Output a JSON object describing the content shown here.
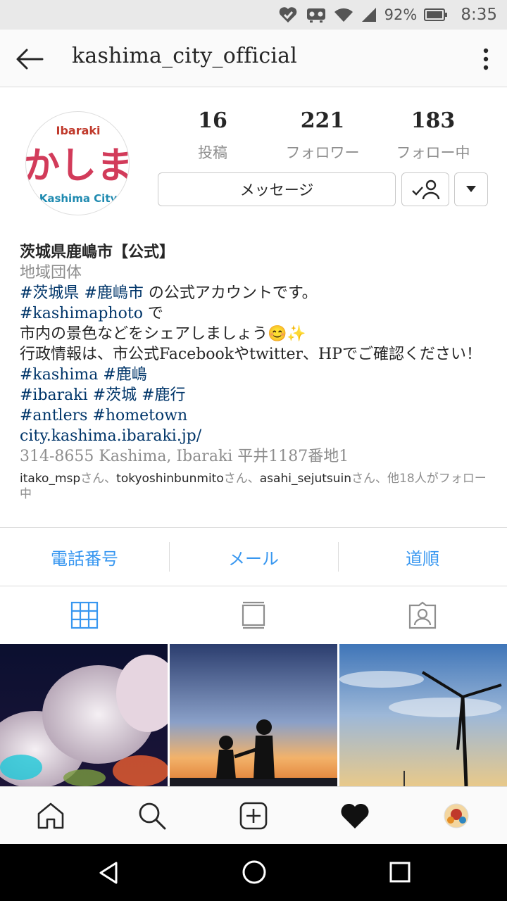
{
  "status": {
    "battery": "92%",
    "time": "8:35"
  },
  "header": {
    "username": "kashima_city_official"
  },
  "profile": {
    "logo_top": "Ibaraki",
    "logo_main": "かしま",
    "logo_bottom": "Kashima City",
    "posts_count": "16",
    "posts_label": "投稿",
    "followers_count": "221",
    "followers_label": "フォロワー",
    "following_count": "183",
    "following_label": "フォロー中",
    "message_label": "メッセージ"
  },
  "bio": {
    "name": "茨城県鹿嶋市【公式】",
    "category": "地域団体",
    "tag1": "#茨城県",
    "tag2": "#鹿嶋市",
    "line1_rest": " の公式アカウントです。",
    "tag3": "#kashimaphoto",
    "line2_rest": " で",
    "line3": "市内の景色などをシェアしましょう😊✨",
    "line4": "行政情報は、市公式Facebookやtwitter、HPでご確認ください！",
    "tags5": "#kashima #鹿嶋",
    "tags6": "#ibaraki #茨城 #鹿行",
    "tags7": "#antlers  #hometown",
    "website": "city.kashima.ibaraki.jp/",
    "address": "314-8655 Kashima, Ibaraki 平井1187番地1",
    "followed_user1": "itako_msp",
    "followed_sep1": "さん、",
    "followed_user2": "tokyoshinbunmito",
    "followed_sep2": "さん、",
    "followed_user3": "asahi_sejutsuin",
    "followed_tail": "さん、他18人がフォロー中"
  },
  "actions": {
    "phone": "電話番号",
    "email": "メール",
    "directions": "道順"
  },
  "colors": {
    "link": "#3897f0",
    "hashtag": "#003569",
    "grid_active": "#3897f0"
  }
}
